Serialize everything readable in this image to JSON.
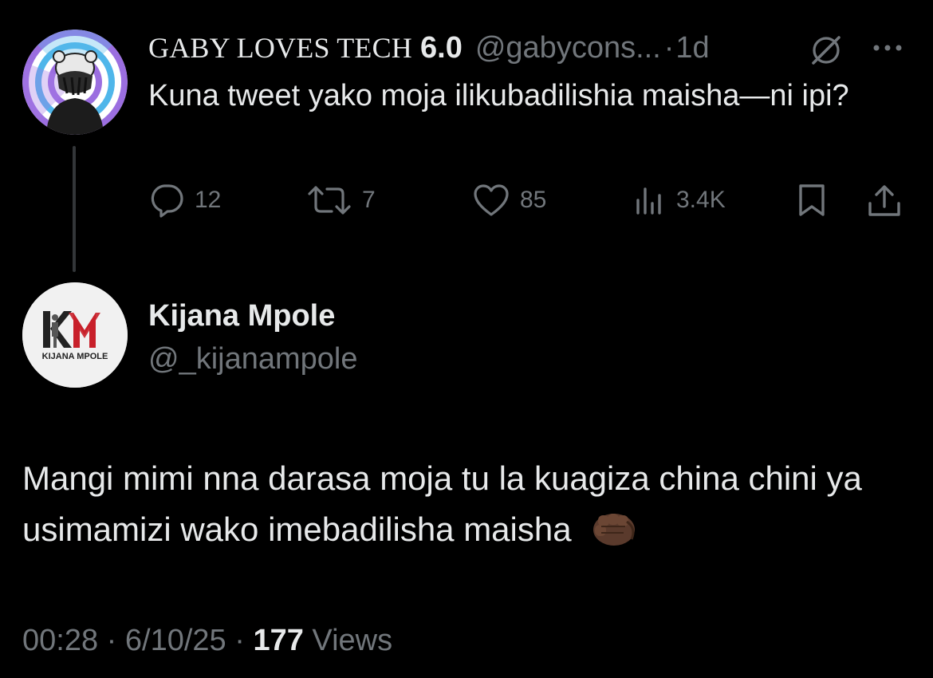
{
  "parent_tweet": {
    "author_name": "GABY LOVES TECH",
    "author_name_suffix": "6.0",
    "handle": "@gabycons...",
    "separator": "·",
    "time": "1d",
    "text": "Kuna tweet yako moja ilikubadilishia maisha—ni ipi?",
    "avatar_icon": "hypnotic-spiral-avatar",
    "actions": {
      "replies": "12",
      "reposts": "7",
      "likes": "85",
      "views": "3.4K"
    }
  },
  "reply_tweet": {
    "author_name": "Kijana Mpole",
    "handle": "@_kijanampole",
    "avatar_logo_text": "KIJANA MPOLE",
    "text": "Mangi mimi nna darasa moja tu la kuagiza china chini ya usimamizi wako imebadilisha maisha",
    "emoji_icon": "fist-emoji",
    "time": "00:28",
    "separator_1": "·",
    "date": "6/10/25",
    "separator_2": "·",
    "views_count": "177",
    "views_label": "Views"
  },
  "colors": {
    "background": "#000000",
    "primary_text": "#e7e9ea",
    "secondary_text": "#71767b",
    "thread_line": "#333639",
    "logo_red": "#c8202a"
  }
}
